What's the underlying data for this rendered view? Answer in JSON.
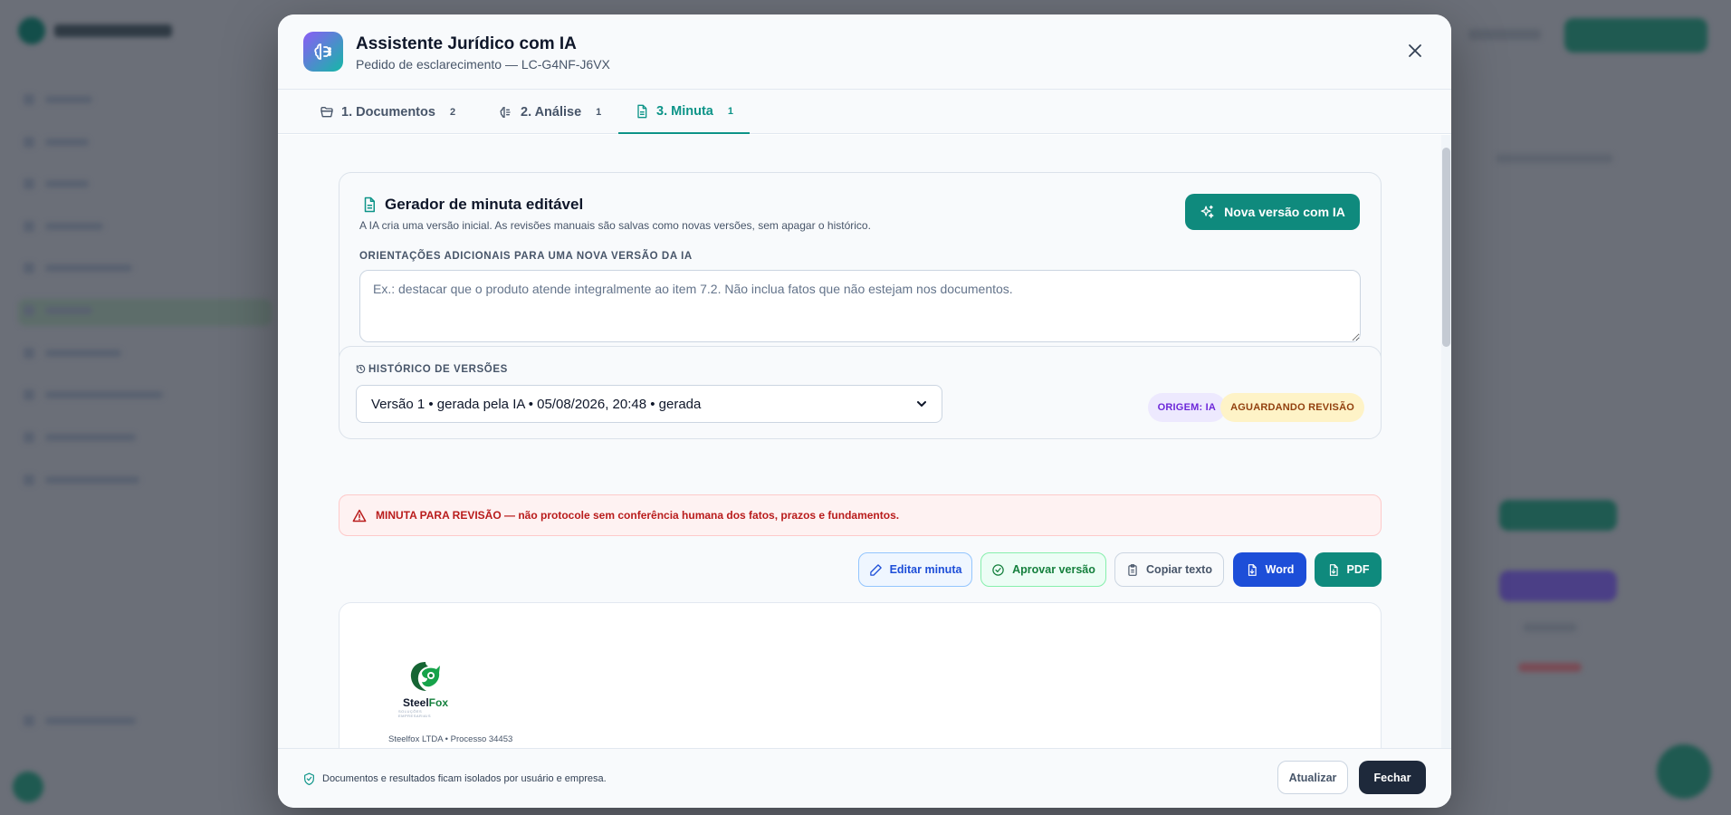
{
  "modal": {
    "title": "Assistente Jurídico com IA",
    "subtitle": "Pedido de esclarecimento — LC-G4NF-J6VX",
    "close_icon": "close-icon"
  },
  "tabs": [
    {
      "label": "1. Documentos",
      "count": "2",
      "icon": "folder-icon",
      "active": false
    },
    {
      "label": "2. Análise",
      "count": "1",
      "icon": "ai-brain-icon",
      "active": false
    },
    {
      "label": "3. Minuta",
      "count": "1",
      "icon": "document-icon",
      "active": true
    }
  ],
  "generator": {
    "title": "Gerador de minuta editável",
    "description": "A IA cria uma versão inicial. As revisões manuais são salvas como novas versões, sem apagar o histórico.",
    "new_version_button": "Nova versão com IA",
    "instructions_label": "ORIENTAÇÕES ADICIONAIS PARA UMA NOVA VERSÃO DA IA",
    "instructions_value": "",
    "instructions_placeholder": "Ex.: destacar que o produto atende integralmente ao item 7.2. Não inclua fatos que não estejam nos documentos."
  },
  "history": {
    "label": "HISTÓRICO DE VERSÕES",
    "selected_version": "Versão 1 • gerada pela IA • 05/08/2026, 20:48 • gerada",
    "origin_badge": "ORIGEM: IA",
    "status_badge": "AGUARDANDO REVISÃO"
  },
  "alert": {
    "text": "MINUTA PARA REVISÃO — não protocole sem conferência humana dos fatos, prazos e fundamentos."
  },
  "actions": {
    "edit": "Editar minuta",
    "approve": "Aprovar versão",
    "copy": "Copiar texto",
    "word": "Word",
    "pdf": "PDF"
  },
  "document": {
    "logo_name_a": "Steel",
    "logo_name_b": "Fox",
    "logo_tagline": "SOLUÇÕES EMPRESARIAIS",
    "meta": "Steelfox LTDA • Processo 34453"
  },
  "footer": {
    "note": "Documentos e resultados ficam isolados por usuário e empresa.",
    "refresh_button": "Atualizar",
    "close_button": "Fechar"
  },
  "colors": {
    "accent": "#0d9488",
    "primary_blue": "#1d4ed8",
    "danger": "#b91c1c",
    "dark": "#1e293b"
  }
}
